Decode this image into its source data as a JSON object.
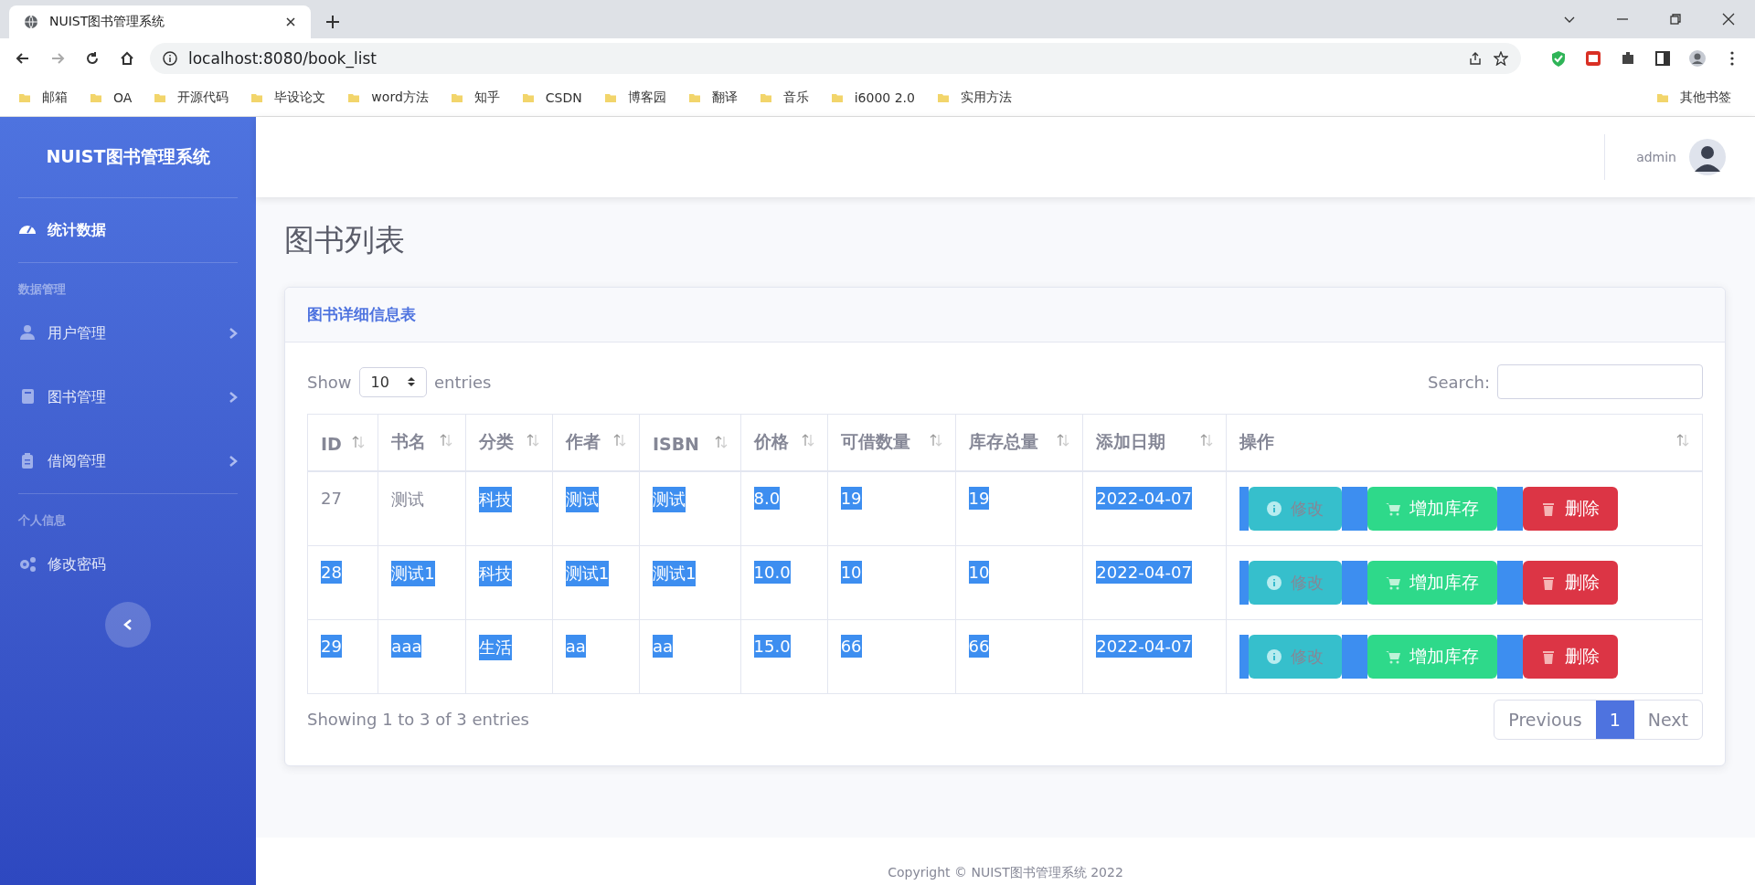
{
  "browser": {
    "tab_title": "NUIST图书管理系统",
    "url": "localhost:8080/book_list",
    "bookmarks": [
      "邮箱",
      "OA",
      "开源代码",
      "毕设论文",
      "word方法",
      "知乎",
      "CSDN",
      "博客园",
      "翻译",
      "音乐",
      "i6000 2.0",
      "实用方法"
    ],
    "other_bookmarks": "其他书签"
  },
  "sidebar": {
    "brand": "NUIST图书管理系统",
    "sections": [
      {
        "items": [
          {
            "label": "统计数据",
            "selected": true,
            "expandable": false
          }
        ]
      },
      {
        "heading": "数据管理",
        "items": [
          {
            "label": "用户管理",
            "selected": false,
            "expandable": true
          },
          {
            "label": "图书管理",
            "selected": false,
            "expandable": true
          },
          {
            "label": "借阅管理",
            "selected": false,
            "expandable": true
          }
        ]
      },
      {
        "heading": "个人信息",
        "items": [
          {
            "label": "修改密码",
            "selected": false,
            "expandable": false
          }
        ]
      }
    ]
  },
  "topbar": {
    "user": "admin"
  },
  "page_title": "图书列表",
  "card": {
    "title": "图书详细信息表",
    "show_label": "Show",
    "page_size": "10",
    "entries_label": "entries",
    "search_label": "Search:",
    "table": {
      "columns": [
        "ID",
        "书名",
        "分类",
        "作者",
        "ISBN",
        "价格",
        "可借数量",
        "库存总量",
        "添加日期",
        "操作"
      ],
      "rows": [
        {
          "cells": [
            {
              "text": "27",
              "highlighted": false
            },
            {
              "text": "测试",
              "highlighted": false
            },
            {
              "text": "科技",
              "highlighted": true
            },
            {
              "text": "测试",
              "highlighted": true
            },
            {
              "text": "测试",
              "highlighted": true
            },
            {
              "text": "8.0",
              "highlighted": true
            },
            {
              "text": "19",
              "highlighted": true
            },
            {
              "text": "19",
              "highlighted": true
            },
            {
              "text": "2022-04-07",
              "highlighted": true
            }
          ],
          "actions": [
            "修改",
            "增加库存",
            "删除"
          ]
        },
        {
          "cells": [
            {
              "text": "28",
              "highlighted": true
            },
            {
              "text": "测试1",
              "highlighted": true
            },
            {
              "text": "科技",
              "highlighted": true
            },
            {
              "text": "测试1",
              "highlighted": true
            },
            {
              "text": "测试1",
              "highlighted": true
            },
            {
              "text": "10.0",
              "highlighted": true
            },
            {
              "text": "10",
              "highlighted": true
            },
            {
              "text": "10",
              "highlighted": true
            },
            {
              "text": "2022-04-07",
              "highlighted": true
            }
          ],
          "actions": [
            "修改",
            "增加库存",
            "删除"
          ]
        },
        {
          "cells": [
            {
              "text": "29",
              "highlighted": true
            },
            {
              "text": "aaa",
              "highlighted": true
            },
            {
              "text": "生活",
              "highlighted": true
            },
            {
              "text": "aa",
              "highlighted": true
            },
            {
              "text": "aa",
              "highlighted": true
            },
            {
              "text": "15.0",
              "highlighted": true
            },
            {
              "text": "66",
              "highlighted": true
            },
            {
              "text": "66",
              "highlighted": true
            },
            {
              "text": "2022-04-07",
              "highlighted": true
            }
          ],
          "actions": [
            "修改",
            "增加库存",
            "删除"
          ]
        }
      ]
    },
    "info": "Showing 1 to 3 of 3 entries",
    "pagination": [
      {
        "label": "Previous",
        "selected": false
      },
      {
        "label": "1",
        "selected": true
      },
      {
        "label": "Next",
        "selected": false
      }
    ]
  },
  "footer": "Copyright © NUIST图书管理系统 2022"
}
